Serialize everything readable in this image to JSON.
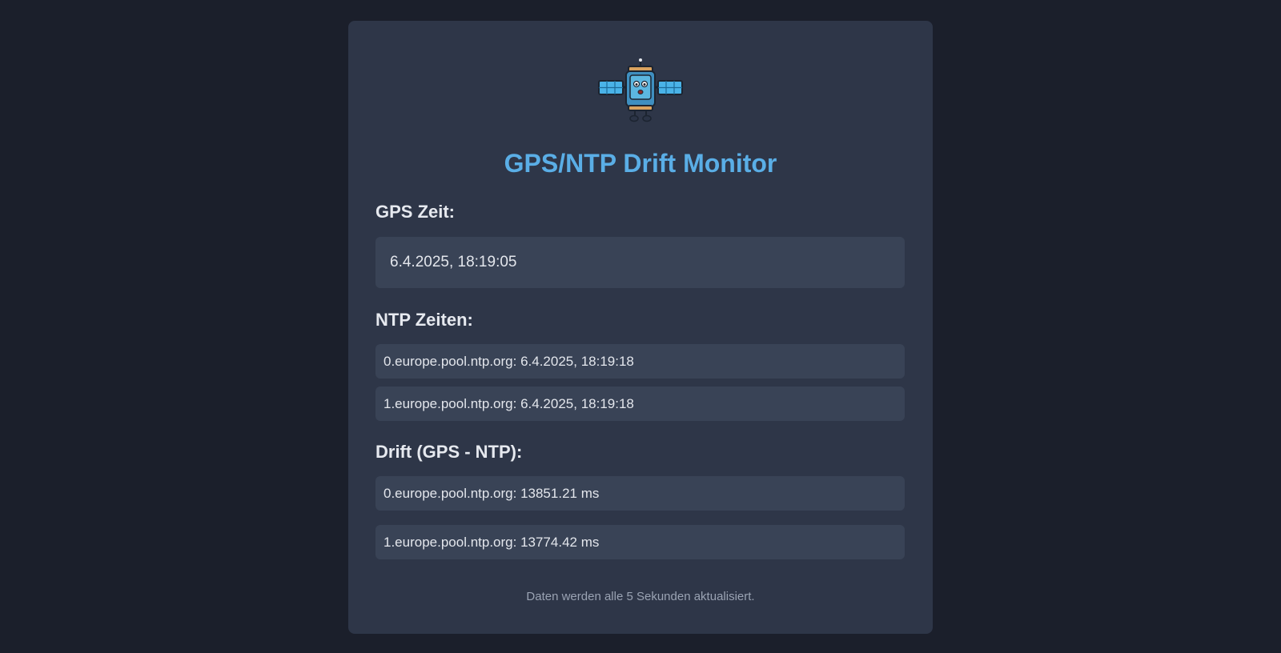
{
  "title": "GPS/NTP Drift Monitor",
  "logo_icon": "satellite-robot-icon",
  "gps": {
    "label": "GPS Zeit:",
    "value": "6.4.2025, 18:19:05"
  },
  "ntp": {
    "label": "NTP Zeiten:",
    "items": [
      "0.europe.pool.ntp.org: 6.4.2025, 18:19:18",
      "1.europe.pool.ntp.org: 6.4.2025, 18:19:18"
    ]
  },
  "drift": {
    "label": "Drift (GPS - NTP):",
    "items": [
      "0.europe.pool.ntp.org: 13851.21 ms",
      "1.europe.pool.ntp.org: 13774.42 ms"
    ]
  },
  "footer": "Daten werden alle 5 Sekunden aktualisiert.",
  "colors": {
    "background": "#1b1f2b",
    "card": "#2e3648",
    "box": "#394356",
    "accent": "#5aaee6"
  }
}
